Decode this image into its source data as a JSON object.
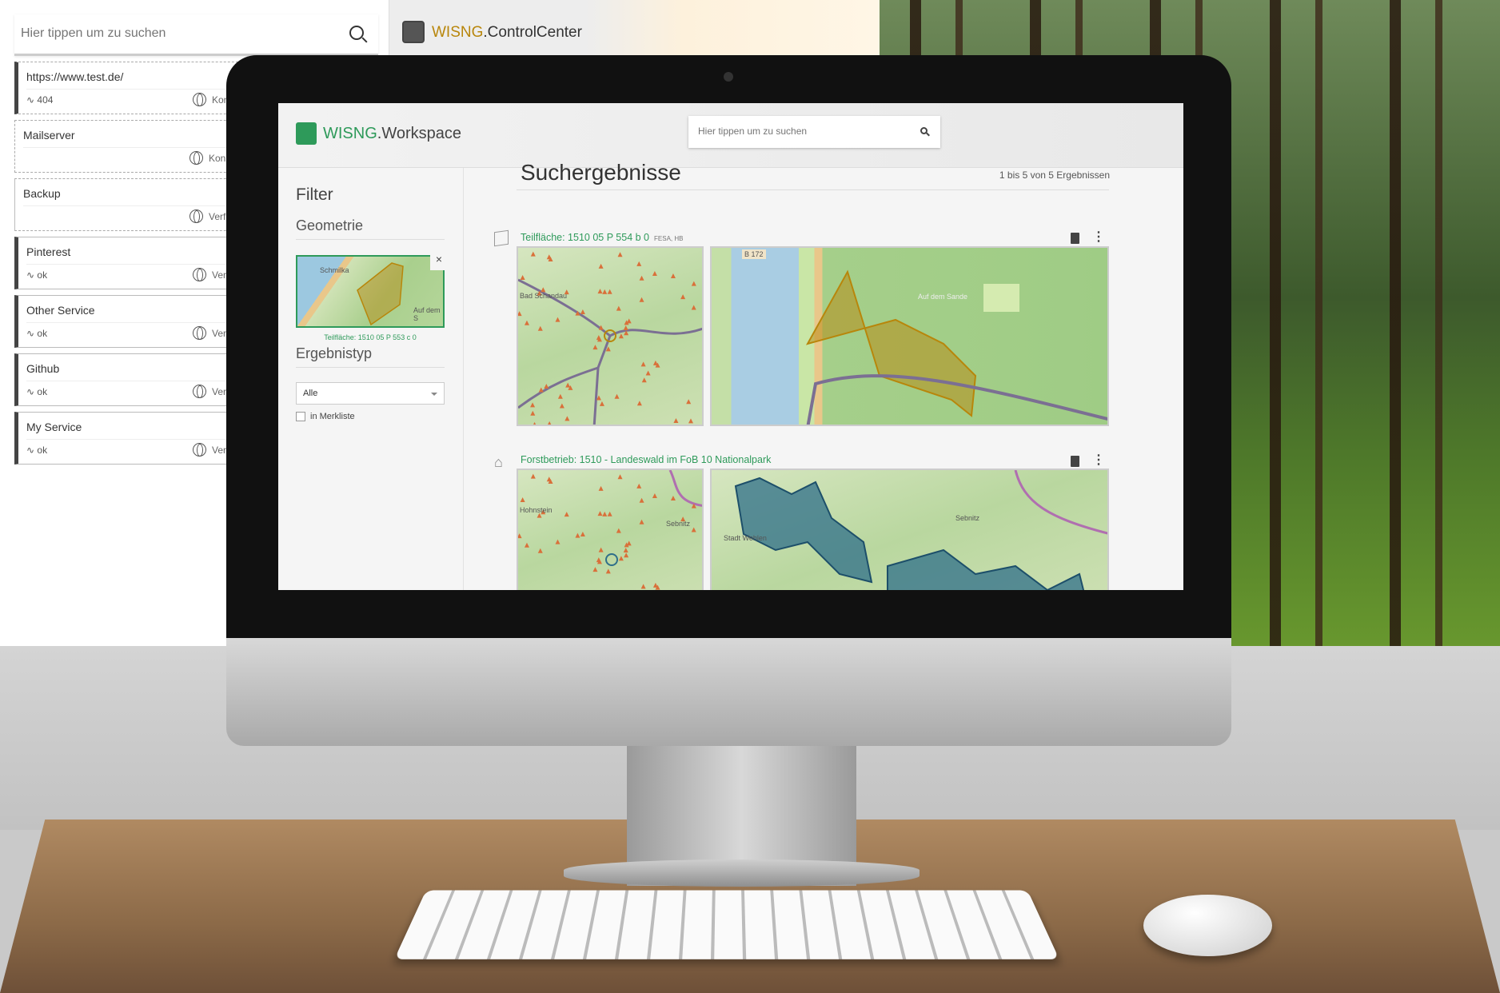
{
  "background_app": {
    "title_prefix": "WISNG",
    "title_suffix": ".ControlCenter",
    "search_placeholder": "Hier tippen um zu suchen",
    "services": [
      {
        "name": "https://www.test.de/",
        "status": "404",
        "info": "Konz"
      },
      {
        "name": "Mailserver",
        "status": "",
        "info": "Konz"
      },
      {
        "name": "Backup",
        "status": "",
        "info": "Verf"
      },
      {
        "name": "Pinterest",
        "status": "ok",
        "info": "Verf"
      },
      {
        "name": "Other Service",
        "status": "ok",
        "info": "Verf"
      },
      {
        "name": "Github",
        "status": "ok",
        "info": "Verf"
      },
      {
        "name": "My Service",
        "status": "ok",
        "info": "Verf"
      }
    ]
  },
  "workspace": {
    "title_prefix": "WISNG",
    "title_suffix": ".Workspace",
    "search_placeholder": "Hier tippen um zu suchen",
    "filter": {
      "heading": "Filter",
      "geometry_heading": "Geometrie",
      "geometry_label": "Teilfläche: 1510 05 P 553 c 0",
      "geometry_close": "×",
      "result_type_heading": "Ergebnistyp",
      "result_type_value": "Alle",
      "watchlist_label": "in Merkliste",
      "watchlist_checked": false
    },
    "results": {
      "heading": "Suchergebnisse",
      "count": "1 bis 5 von 5 Ergebnissen",
      "items": [
        {
          "title": "Teilfläche: 1510 05 P 554 b 0",
          "tags": "FESA, HB",
          "icon": "polygon-icon",
          "map_labels": [
            "Bad Schandau",
            "B 172",
            "Auf dem Sande"
          ]
        },
        {
          "title": "Forstbetrieb: 1510 - Landeswald im FoB 10 Nationalpark",
          "tags": "",
          "icon": "house-icon",
          "map_labels": [
            "Hohnstein",
            "Sebnitz",
            "Stadt Wehlen",
            "Sebnitz"
          ]
        }
      ]
    },
    "geometry_map_labels": [
      "Schmilka",
      "Auf dem S"
    ],
    "colors": {
      "accent": "#2e9a5a",
      "polygon": "#b8860b",
      "area": "#2f6f8a"
    }
  }
}
